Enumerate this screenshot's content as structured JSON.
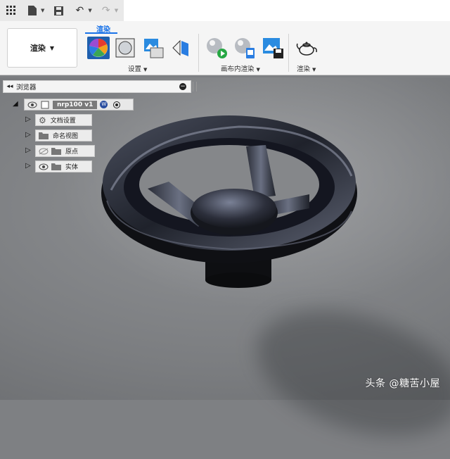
{
  "quickbar": {
    "icons": [
      "grid-icon",
      "file-icon",
      "save-icon",
      "undo-icon",
      "redo-icon"
    ]
  },
  "ribbon": {
    "workspace_label": "渲染",
    "active_tab": "渲染",
    "groups": {
      "setup": "设置",
      "canvas_render": "画布内渲染",
      "render": "渲染"
    },
    "accent_color": "#1a73e8"
  },
  "browser": {
    "title": "浏览器",
    "root_name": "nrp100 v1",
    "nodes": [
      {
        "label": "文档设置",
        "icon": "gear-icon"
      },
      {
        "label": "命名视图",
        "icon": "folder-icon"
      },
      {
        "label": "原点",
        "icon": "folder-icon",
        "hidden": true
      },
      {
        "label": "实体",
        "icon": "folder-icon"
      }
    ]
  },
  "watermark": "头条 @糖苦小屋"
}
